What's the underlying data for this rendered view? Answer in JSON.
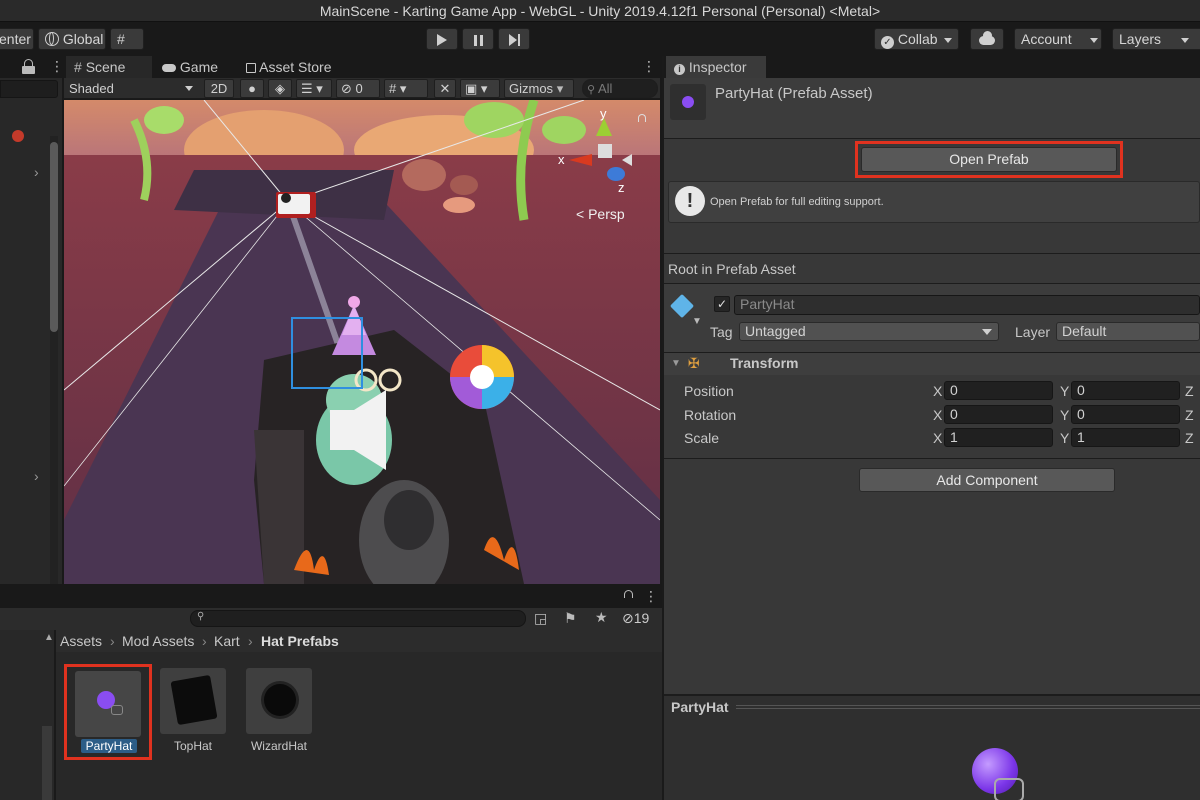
{
  "window": {
    "title": "MainScene - Karting Game App - WebGL - Unity 2019.4.12f1 Personal (Personal) <Metal>"
  },
  "toolbar": {
    "pivot_label": "enter",
    "global_label": "Global",
    "collab_label": "Collab",
    "account_label": "Account",
    "layers_label": "Layers"
  },
  "scene_tabs": {
    "scene": "Scene",
    "game": "Game",
    "asset_store": "Asset Store"
  },
  "scene_toolbar": {
    "shading_mode": "Shaded",
    "mode_2d": "2D",
    "hidden_count": "0",
    "gizmos_label": "Gizmos",
    "search_placeholder": "All"
  },
  "scene_view": {
    "persp_label": "Persp",
    "axis_x": "x",
    "axis_y": "y",
    "axis_z": "z"
  },
  "project": {
    "hidden_count": "19",
    "breadcrumb": [
      "Assets",
      "Mod Assets",
      "Kart",
      "Hat Prefabs"
    ],
    "assets": [
      {
        "name": "PartyHat",
        "selected": true
      },
      {
        "name": "TopHat",
        "selected": false
      },
      {
        "name": "WizardHat",
        "selected": false
      }
    ]
  },
  "inspector": {
    "tab_label": "Inspector",
    "asset_title": "PartyHat (Prefab Asset)",
    "open_prefab_label": "Open Prefab",
    "help_text": "Open Prefab for full editing support.",
    "root_label": "Root in Prefab Asset",
    "object_name": "PartyHat",
    "tag_label": "Tag",
    "tag_value": "Untagged",
    "layer_label": "Layer",
    "layer_value": "Default",
    "transform_label": "Transform",
    "position_label": "Position",
    "rotation_label": "Rotation",
    "scale_label": "Scale",
    "axis_x": "X",
    "axis_y": "Y",
    "axis_z": "Z",
    "position": {
      "x": "0",
      "y": "0"
    },
    "rotation": {
      "x": "0",
      "y": "0"
    },
    "scale": {
      "x": "1",
      "y": "1"
    },
    "add_component_label": "Add Component",
    "preview_title": "PartyHat"
  },
  "colors": {
    "highlight": "#e0321f",
    "selection": "#2c5d87",
    "accent_purple": "#8a4df2"
  }
}
